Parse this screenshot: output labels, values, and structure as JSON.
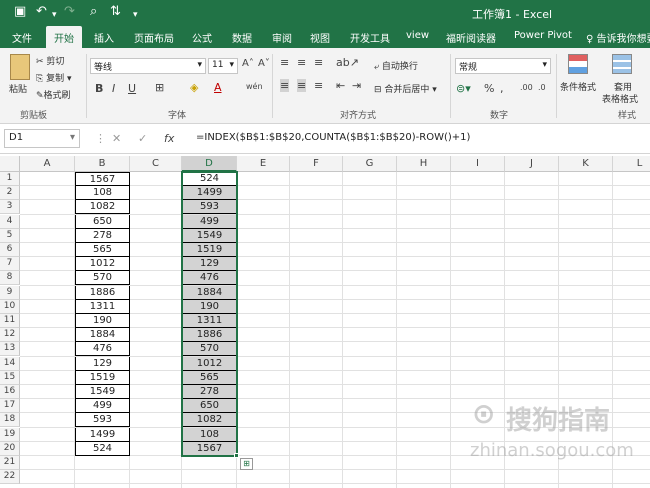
{
  "window": {
    "title": "工作簿1 - Excel"
  },
  "quick_access": {
    "save_icon": "floppy-icon",
    "undo_icon": "undo-icon",
    "redo_icon": "redo-icon",
    "preview_icon": "print-preview-icon",
    "sort_icon": "sort-icon",
    "more_icon": "customize-icon"
  },
  "tabs": [
    {
      "label": "文件"
    },
    {
      "label": "开始"
    },
    {
      "label": "插入"
    },
    {
      "label": "页面布局"
    },
    {
      "label": "公式"
    },
    {
      "label": "数据"
    },
    {
      "label": "审阅"
    },
    {
      "label": "视图"
    },
    {
      "label": "开发工具"
    },
    {
      "label": "view"
    },
    {
      "label": "福昕阅读器"
    },
    {
      "label": "Power Pivot"
    }
  ],
  "tell_me": "告诉我你想要",
  "ribbon": {
    "clipboard": {
      "paste": "粘贴",
      "cut": "剪切",
      "copy": "复制",
      "format_painter": "格式刷",
      "label": "剪贴板"
    },
    "font": {
      "name": "等线",
      "size": "11",
      "label": "字体"
    },
    "alignment": {
      "wrap": "自动换行",
      "merge": "合并后居中",
      "label": "对齐方式"
    },
    "number": {
      "format": "常规",
      "label": "数字"
    },
    "styles": {
      "conditional": "条件格式",
      "table": "套用",
      "table2": "表格格式",
      "label": "样式"
    }
  },
  "formula_bar": {
    "name_box": "D1",
    "formula": "=INDEX($B$1:$B$20,COUNTA($B$1:$B$20)-ROW()+1)"
  },
  "columns": [
    "A",
    "B",
    "C",
    "D",
    "E",
    "F",
    "G",
    "H",
    "I",
    "J",
    "K",
    "L"
  ],
  "rows": [
    "1",
    "2",
    "3",
    "4",
    "5",
    "6",
    "7",
    "8",
    "9",
    "10",
    "11",
    "12",
    "13",
    "14",
    "15",
    "16",
    "17",
    "18",
    "19",
    "20",
    "21",
    "22"
  ],
  "col_b": [
    "1567",
    "108",
    "1082",
    "650",
    "278",
    "565",
    "1012",
    "570",
    "1886",
    "1311",
    "190",
    "1884",
    "476",
    "129",
    "1519",
    "1549",
    "499",
    "593",
    "1499",
    "524"
  ],
  "col_d": [
    "524",
    "1499",
    "593",
    "499",
    "1549",
    "1519",
    "129",
    "476",
    "1884",
    "190",
    "1311",
    "1886",
    "570",
    "1012",
    "565",
    "278",
    "650",
    "1082",
    "108",
    "1567"
  ],
  "watermark": {
    "text": "搜狗指南",
    "url": "zhinan.sogou.com"
  }
}
